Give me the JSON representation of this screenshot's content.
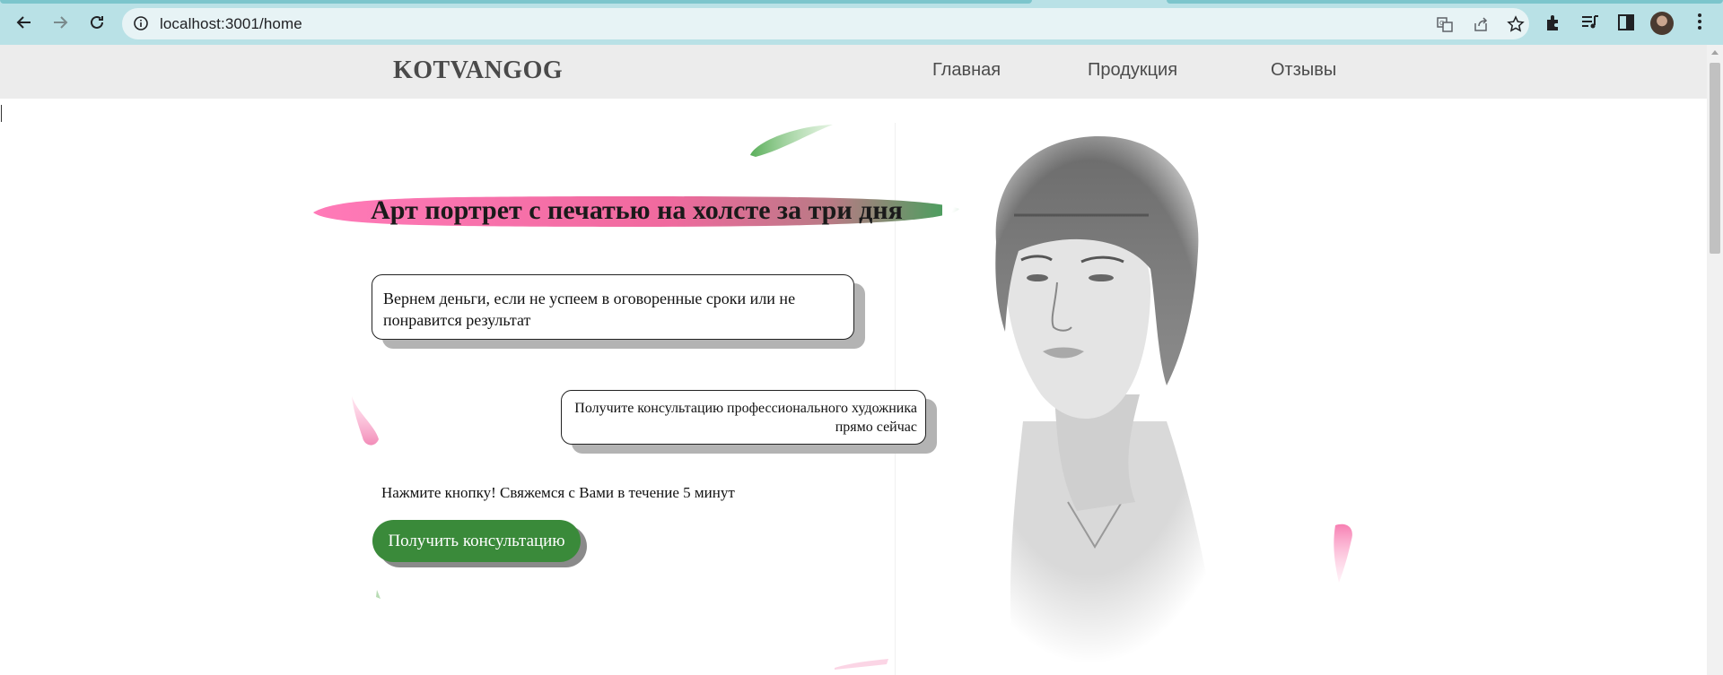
{
  "browser": {
    "url": "localhost:3001/home",
    "icons": {
      "back": "back-arrow-icon",
      "forward": "forward-arrow-icon",
      "reload": "reload-icon",
      "site_info": "info-icon",
      "translate": "translate-icon",
      "share": "share-icon",
      "bookmark": "star-icon",
      "extensions": "puzzle-icon",
      "media": "media-queue-icon",
      "side_panel": "side-panel-icon",
      "profile": "avatar",
      "menu": "kebab-menu-icon"
    }
  },
  "header": {
    "brand": "KOTVANGOG",
    "nav": [
      {
        "label": "Главная"
      },
      {
        "label": "Продукция"
      },
      {
        "label": "Отзывы"
      }
    ]
  },
  "hero": {
    "title": "Арт портрет с печатью на холсте за три дня",
    "guarantee_text": "Вернем деньги, если не успеем в оговоренные сроки или не понравится результат",
    "consult_text": "Получите консультацию профессионального художника прямо сейчас",
    "cta_note": "Нажмите кнопку! Свяжемся с Вами в течение 5 минут",
    "cta_button": "Получить консультацию"
  },
  "colors": {
    "chrome": "#b9e1e6",
    "header_bg": "#ececec",
    "accent_green": "#3a8a3a",
    "accent_pink": "#f06aa3"
  }
}
